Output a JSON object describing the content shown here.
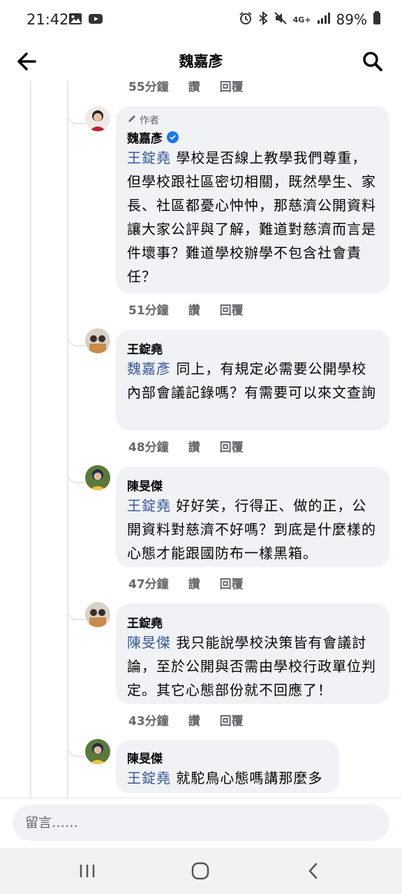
{
  "status": {
    "time": "21:42",
    "network": "4G+",
    "battery": "89%",
    "icons": [
      "gallery-icon",
      "youtube-icon",
      "alarm-icon",
      "bluetooth-icon",
      "mute-icon",
      "signal-icon",
      "battery-icon"
    ]
  },
  "header": {
    "title": "魏嘉彥",
    "back_icon": "back-arrow-icon",
    "search_icon": "search-icon"
  },
  "top_meta": {
    "time": "55分鐘",
    "like": "讚",
    "reply": "回覆"
  },
  "comments": [
    {
      "author_tag": "作者",
      "name": "魏嘉彥",
      "verified": true,
      "mention": "王錠堯",
      "text": "學校是否線上教學我們尊重，但學校跟社區密切相關，既然學生、家長、社區都憂心忡忡，那慈濟公開資料讓大家公評與了解，難道對慈濟而言是件壞事？難道學校辦學不包含社會責任？",
      "time": "51分鐘",
      "like": "讚",
      "reply": "回覆"
    },
    {
      "name": "王錠堯",
      "mention": "魏嘉彥",
      "text": "同上，有規定必需要公開學校內部會議記錄嗎？有需要可以來文查詢",
      "time": "48分鐘",
      "like": "讚",
      "reply": "回覆"
    },
    {
      "name": "陳旻傑",
      "mention": "王錠堯",
      "text": "好好笑，行得正、做的正，公開資料對慈濟不好嗎？到底是什麼樣的心態才能跟國防布一樣黑箱。",
      "time": "47分鐘",
      "like": "讚",
      "reply": "回覆"
    },
    {
      "name": "王錠堯",
      "mention": "陳旻傑",
      "text": "我只能說學校決策皆有會議討論，至於公開與否需由學校行政單位判定。其它心態部份就不回應了！",
      "time": "43分鐘",
      "like": "讚",
      "reply": "回覆"
    },
    {
      "name": "陳旻傑",
      "mention": "王錠堯",
      "text": "就駝鳥心態嗎講那麼多"
    }
  ],
  "input": {
    "placeholder": "留言……"
  },
  "nav": {
    "recent_icon": "recent-apps-icon",
    "home_icon": "home-icon",
    "back_icon": "nav-back-icon"
  },
  "colors": {
    "mention": "#385898",
    "bubble": "#f0f2f5",
    "verified": "#1877f2",
    "meta": "#65676b"
  }
}
